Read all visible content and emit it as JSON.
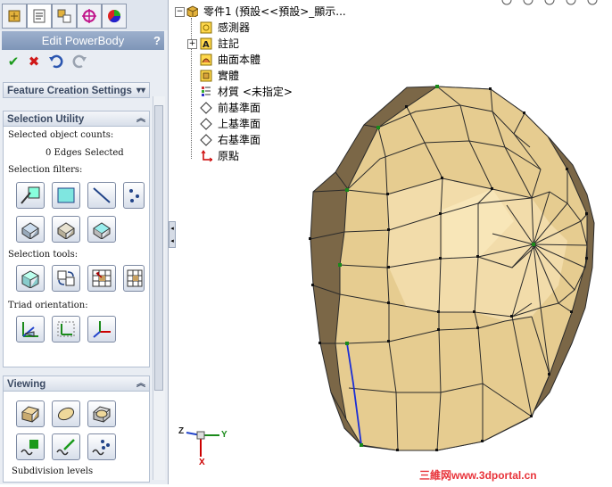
{
  "panel": {
    "tabs": [
      "feature-manager-icon",
      "property-manager-icon",
      "configuration-manager-icon",
      "dimxpert-icon",
      "display-manager-icon"
    ],
    "title": "Edit PowerBody",
    "help": "?",
    "feature_creation_settings": "Feature Creation Settings",
    "selection_utility": {
      "title": "Selection Utility",
      "counts_label": "Selected object counts:",
      "counts_value": "0 Edges Selected",
      "filters_label": "Selection filters:",
      "tools_label": "Selection tools:",
      "triad_label": "Triad orientation:"
    },
    "viewing": {
      "title": "Viewing",
      "subdivision_label": "Subdivision levels"
    }
  },
  "tree": {
    "root": "零件1 (預設<<預設>_顯示...",
    "items": [
      {
        "label": "感測器",
        "icon": "sensor-icon"
      },
      {
        "label": "註記",
        "icon": "annotation-icon"
      },
      {
        "label": "曲面本體",
        "icon": "surface-body-icon"
      },
      {
        "label": "實體",
        "icon": "solid-body-icon"
      },
      {
        "label": "材質 <未指定>",
        "icon": "material-icon"
      },
      {
        "label": "前基準面",
        "icon": "plane-icon"
      },
      {
        "label": "上基準面",
        "icon": "plane-icon"
      },
      {
        "label": "右基準面",
        "icon": "plane-icon"
      },
      {
        "label": "原點",
        "icon": "origin-icon"
      }
    ]
  },
  "triad": {
    "z": "Z",
    "y": "Y",
    "x": "X"
  },
  "watermark": "三維网www.3dportal.cn",
  "colors": {
    "face": "#e8cf94",
    "dark_face": "#7a6646",
    "edge": "#2a2a2a",
    "vertex_green": "#1a8a1a",
    "selected_edge": "#1a2ed6"
  }
}
